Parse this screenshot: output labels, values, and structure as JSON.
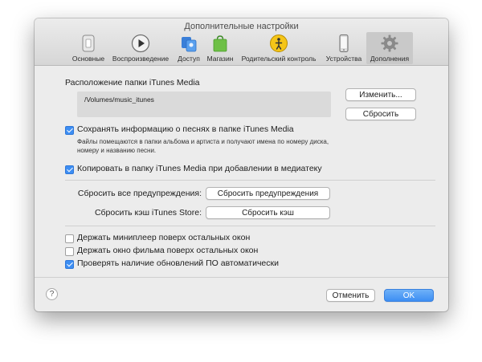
{
  "window": {
    "title": "Дополнительные настройки"
  },
  "toolbar": {
    "items": [
      {
        "label": "Основные",
        "icon": "phone-switch-icon"
      },
      {
        "label": "Воспроизведение",
        "icon": "play-icon"
      },
      {
        "label": "Доступ",
        "icon": "sharing-icon"
      },
      {
        "label": "Магазин",
        "icon": "store-bag-icon"
      },
      {
        "label": "Родительский контроль",
        "icon": "parental-control-icon"
      },
      {
        "label": "Устройства",
        "icon": "iphone-icon"
      },
      {
        "label": "Дополнения",
        "icon": "gear-icon",
        "active": true
      }
    ]
  },
  "media": {
    "section_title": "Расположение папки iTunes Media",
    "path": "/Volumes/music_itunes",
    "change_label": "Изменить...",
    "reset_label": "Сбросить"
  },
  "options": {
    "keep_organized": {
      "label": "Сохранять информацию о песнях в папке iTunes Media",
      "checked": true,
      "description": "Файлы помещаются в папки альбома и артиста и получают имена по номеру диска, номеру и названию песни."
    },
    "copy_files": {
      "label": "Копировать в папку iTunes Media при добавлении в медиатеку",
      "checked": true
    }
  },
  "resets": {
    "warnings_label": "Сбросить все предупреждения:",
    "warnings_button": "Сбросить предупреждения",
    "cache_label": "Сбросить кэш iTunes Store:",
    "cache_button": "Сбросить кэш"
  },
  "misc": {
    "miniplayer": {
      "label": "Держать миниплеер поверх остальных окон",
      "checked": false
    },
    "movie_window": {
      "label": "Держать окно фильма поверх остальных окон",
      "checked": false
    },
    "updates": {
      "label": "Проверять наличие обновлений ПО автоматически",
      "checked": true
    }
  },
  "footer": {
    "help": "?",
    "cancel_label": "Отменить",
    "ok_label": "OK"
  },
  "colors": {
    "accent": "#3d8ef3",
    "window_bg": "#ececec"
  }
}
